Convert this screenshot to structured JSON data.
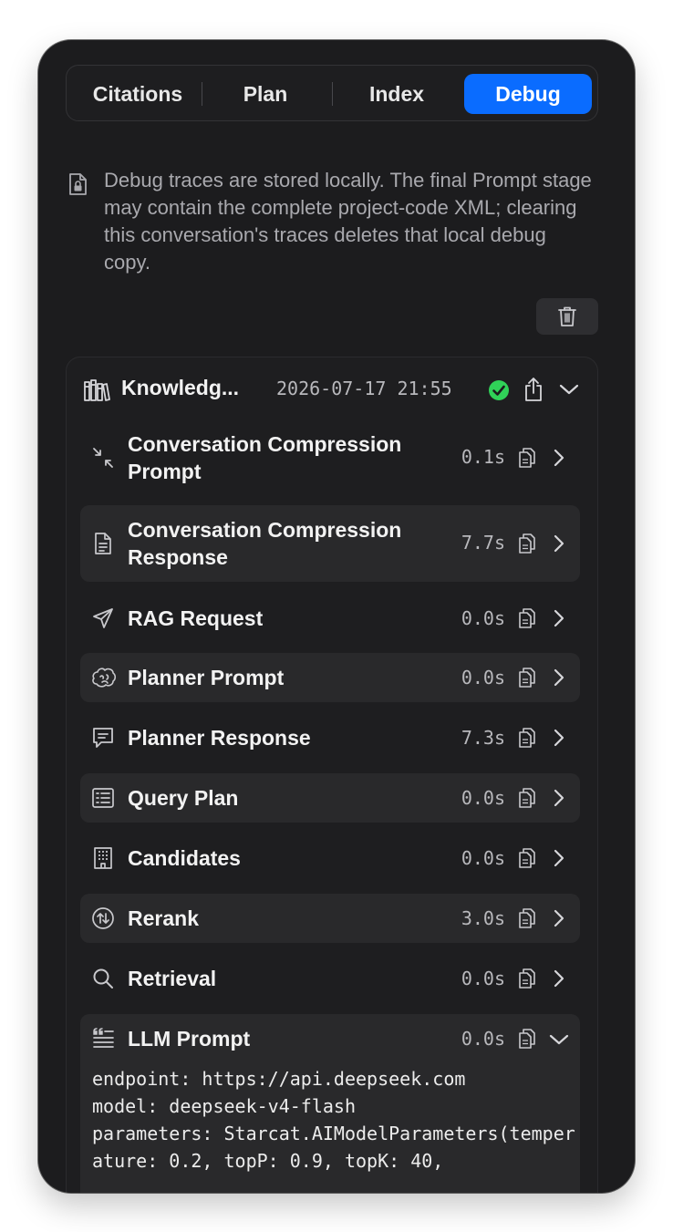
{
  "tabs": [
    "Citations",
    "Plan",
    "Index",
    "Debug"
  ],
  "active_tab": "Debug",
  "info": {
    "icon": "lock-document-icon",
    "text": "Debug traces are stored locally. The final Prompt stage may contain the complete project-code XML; clearing this conversation's traces deletes that local debug copy."
  },
  "trash_button": {
    "icon": "trash-icon"
  },
  "trace": {
    "title": "Knowledg...",
    "timestamp": "2026-07-17 21:55",
    "status": "success",
    "colors": {
      "accent": "#0a6cff",
      "success": "#30d158"
    },
    "stages": [
      {
        "label": "Conversation Compression Prompt",
        "duration": "0.1s",
        "icon": "compress-icon",
        "expanded": false
      },
      {
        "label": "Conversation Compression Response",
        "duration": "7.7s",
        "icon": "document-icon",
        "expanded": false
      },
      {
        "label": "RAG Request",
        "duration": "0.0s",
        "icon": "paper-plane-icon",
        "expanded": false
      },
      {
        "label": "Planner Prompt",
        "duration": "0.0s",
        "icon": "brain-icon",
        "expanded": false
      },
      {
        "label": "Planner Response",
        "duration": "7.3s",
        "icon": "speech-bubble-icon",
        "expanded": false
      },
      {
        "label": "Query Plan",
        "duration": "0.0s",
        "icon": "list-icon",
        "expanded": false
      },
      {
        "label": "Candidates",
        "duration": "0.0s",
        "icon": "building-icon",
        "expanded": false
      },
      {
        "label": "Rerank",
        "duration": "3.0s",
        "icon": "rerank-icon",
        "expanded": false
      },
      {
        "label": "Retrieval",
        "duration": "0.0s",
        "icon": "search-icon",
        "expanded": false
      },
      {
        "label": "LLM Prompt",
        "duration": "0.0s",
        "icon": "quote-text-icon",
        "expanded": true,
        "content": "endpoint: https://api.deepseek.com\nmodel: deepseek-v4-flash\nparameters: Starcat.AIModelParameters(temperature: 0.2, topP: 0.9, topK: 40,"
      }
    ]
  }
}
